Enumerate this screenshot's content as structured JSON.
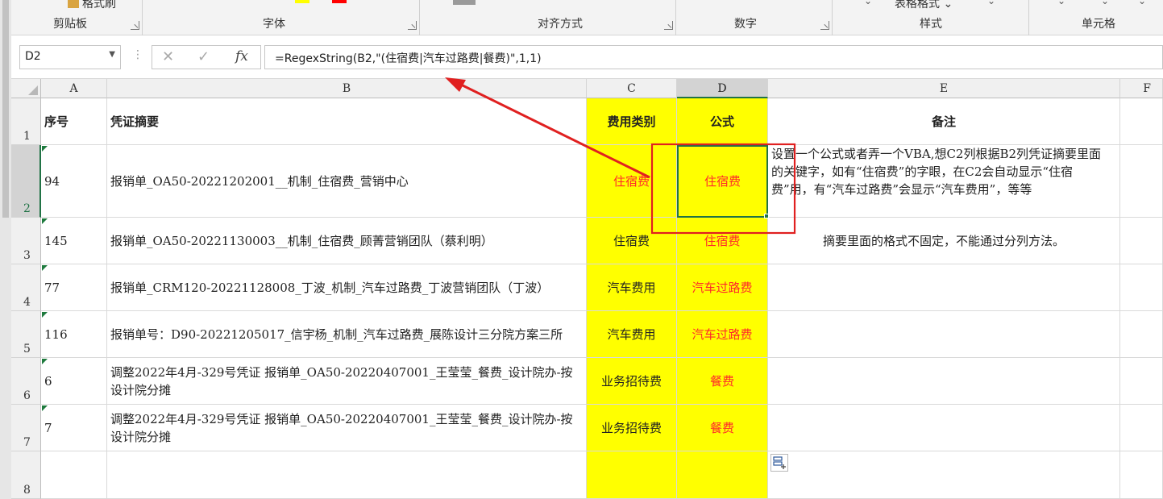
{
  "ribbon": {
    "top_fragments": {
      "format_painter": "格式刷",
      "table_format": "表格格式"
    },
    "groups": [
      "剪贴板",
      "字体",
      "对齐方式",
      "数字",
      "样式",
      "单元格"
    ]
  },
  "formula_bar": {
    "name_box": "D2",
    "formula": "=RegexString(B2,\"(住宿费|汽车过路费|餐费)\",1,1)",
    "icons": [
      "dropdown-icon",
      "more-icon",
      "cancel-icon",
      "enter-icon",
      "insert-function-icon"
    ],
    "fx_label": "fx"
  },
  "grid": {
    "columns": [
      "A",
      "B",
      "C",
      "D",
      "E",
      "F"
    ],
    "selected_column": "D",
    "selected_cell": "D2",
    "row_numbers": [
      "1",
      "2",
      "3",
      "4",
      "5",
      "6",
      "7",
      "8"
    ],
    "header_row": {
      "a": "序号",
      "b": "凭证摘要",
      "c": "费用类别",
      "d": "公式",
      "e": "备注"
    },
    "rows": [
      {
        "a": "94",
        "b": "报销单_OA50-20221202001__机制_住宿费_营销中心",
        "c": "住宿费",
        "d": "住宿费",
        "e": "设置一个公式或者弄一个VBA,想C2列根据B2列凭证摘要里面的关键字，如有“住宿费”的字眼，在C2会自动显示“住宿费”用，有“汽车过路费”会显示“汽车费用”，等等"
      },
      {
        "a": "145",
        "b": "报销单_OA50-20221130003__机制_住宿费_顾菁营销团队（蔡利明）",
        "c": "住宿费",
        "d": "住宿费",
        "e": "摘要里面的格式不固定，不能通过分列方法。"
      },
      {
        "a": "77",
        "b": "报销单_CRM120-20221128008_丁波_机制_汽车过路费_丁波营销团队（丁波）",
        "c": "汽车费用",
        "d": "汽车过路费",
        "e": ""
      },
      {
        "a": "116",
        "b": "报销单号：D90-20221205017_信宇杨_机制_汽车过路费_展陈设计三分院方案三所",
        "c": "汽车费用",
        "d": "汽车过路费",
        "e": ""
      },
      {
        "a": "6",
        "b": "调整2022年4月-329号凭证 报销单_OA50-20220407001_王莹莹_餐费_设计院办-按设计院分摊",
        "c": "业务招待费",
        "d": "餐费",
        "e": ""
      },
      {
        "a": "7",
        "b": "调整2022年4月-329号凭证 报销单_OA50-20220407001_王莹莹_餐费_设计院办-按设计院分摊",
        "c": "业务招待费",
        "d": "餐费",
        "e": ""
      }
    ]
  },
  "colors": {
    "highlight_yellow": "#ffff00",
    "formula_red": "#ff2a2a",
    "annotation_red": "#e02020",
    "selection_green": "#217346"
  }
}
